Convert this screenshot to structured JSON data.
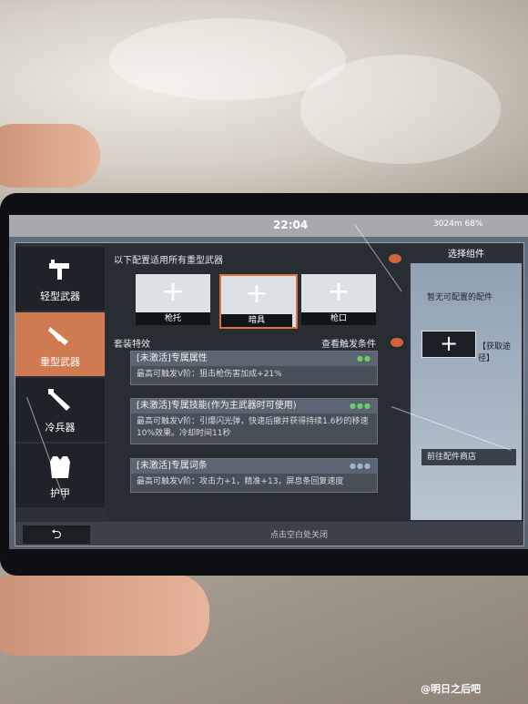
{
  "status_bar": {
    "time": "22:04",
    "network": "3024m 68%"
  },
  "nav": {
    "items": [
      {
        "label": "轻型武器",
        "icon": "uzi-icon",
        "active": false
      },
      {
        "label": "重型武器",
        "icon": "heavy-gun-icon",
        "active": true
      },
      {
        "label": "冷兵器",
        "icon": "blade-icon",
        "active": false
      },
      {
        "label": "护甲",
        "icon": "armor-icon",
        "active": false
      }
    ]
  },
  "main": {
    "hint": "以下配置适用所有重型武器",
    "slots": [
      {
        "label": "枪托",
        "selected": false
      },
      {
        "label": "暗具",
        "selected": true
      },
      {
        "label": "枪口",
        "selected": false
      }
    ],
    "set_effect_title": "套装特效",
    "view_condition": "查看触发条件",
    "cards": [
      {
        "title": "[未激活]专属属性",
        "text": "最高可触发V阶：狙击枪伤害加成+21%"
      },
      {
        "title": "[未激活]专属技能(作为主武器时可使用)",
        "text": "最高可触发V阶：引爆闪光弹，快速后撤并获得持续1.6秒的移速10%效果。冷却时间11秒"
      },
      {
        "title": "[未激活]专属词条",
        "text": "最高可触发V阶：攻击力+1，精准+13，屏息条回复速度"
      }
    ]
  },
  "right_panel": {
    "title": "选择组件",
    "empty_text": "暂无可配置的配件",
    "get_way": "【获取途径】",
    "shop_button": "前往配件商店"
  },
  "bottom": {
    "close_hint": "点击空白处关闭",
    "back_icon": "back-arrow-icon"
  },
  "watermark": "@明日之后吧",
  "colors": {
    "accent": "#d07a52",
    "active_dots": "#6fd06a"
  }
}
